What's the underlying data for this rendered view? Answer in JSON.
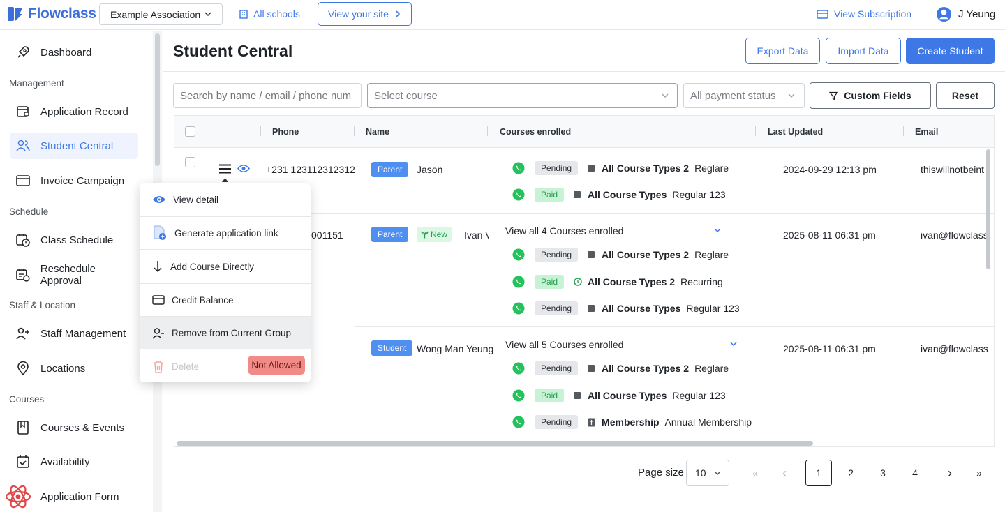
{
  "brand": {
    "name": "Flowclass",
    "color": "#3d78e6"
  },
  "topbar": {
    "association": "Example Association",
    "all_schools": "All schools",
    "view_site": "View your site",
    "view_subscription": "View Subscription",
    "user_name": "J Yeung"
  },
  "sidebar": {
    "dashboard": "Dashboard",
    "sections": {
      "management": "Management",
      "schedule": "Schedule",
      "staff_location": "Staff & Location",
      "courses": "Courses"
    },
    "items": {
      "application_record": "Application Record",
      "student_central": "Student Central",
      "invoice_campaign": "Invoice Campaign",
      "class_schedule": "Class Schedule",
      "reschedule_approval": "Reschedule Approval",
      "staff_management": "Staff Management",
      "locations": "Locations",
      "courses_events": "Courses & Events",
      "availability": "Availability",
      "application_form": "Application Form"
    }
  },
  "page": {
    "title": "Student Central",
    "export": "Export Data",
    "import": "Import Data",
    "create": "Create Student"
  },
  "filters": {
    "search_placeholder": "Search by name / email / phone num",
    "course_placeholder": "Select course",
    "payment_placeholder": "All payment status",
    "custom_fields": "Custom Fields",
    "reset": "Reset"
  },
  "table": {
    "headers": {
      "phone": "Phone",
      "name": "Name",
      "courses": "Courses enrolled",
      "updated": "Last Updated",
      "email": "Email"
    },
    "rows": [
      {
        "phone": "+231 123112312312",
        "role": "Parent",
        "name": "Jason",
        "updated": "2024-09-29 12:13 pm",
        "email": "thiswillnotbeint",
        "courses": [
          {
            "status": "Pending",
            "type": "All Course Types 2",
            "course": "Reglare"
          },
          {
            "status": "Paid",
            "type": "All Course Types",
            "course": "Regular 123"
          }
        ]
      },
      {
        "phone": "001151",
        "role": "Parent",
        "badge": "New",
        "name": "Ivan V",
        "updated": "2025-08-11 06:31 pm",
        "email": "ivan@flowclass",
        "view_all": "View all 4 Courses enrolled",
        "courses": [
          {
            "status": "Pending",
            "type": "All Course Types 2",
            "course": "Reglare"
          },
          {
            "status": "Paid",
            "type": "All Course Types 2",
            "course": "Recurring"
          },
          {
            "status": "Pending",
            "type": "All Course Types",
            "course": "Regular 123"
          }
        ]
      },
      {
        "role": "Student",
        "name": "Wong Man Yeung",
        "updated": "2025-08-11 06:31 pm",
        "email": "ivan@flowclass",
        "view_all": "View all 5 Courses enrolled",
        "courses": [
          {
            "status": "Pending",
            "type": "All Course Types 2",
            "course": "Reglare"
          },
          {
            "status": "Paid",
            "type": "All Course Types",
            "course": "Regular 123"
          },
          {
            "status": "Pending",
            "type": "Membership",
            "course": "Annual Membership"
          }
        ]
      }
    ]
  },
  "context_menu": {
    "view_detail": "View detail",
    "gen_link": "Generate application link",
    "add_course": "Add Course Directly",
    "credit": "Credit Balance",
    "remove_group": "Remove from Current Group",
    "delete": "Delete",
    "not_allowed": "Not Allowed"
  },
  "pagination": {
    "label": "Page size",
    "size": "10",
    "first": "«",
    "prev": "‹",
    "pages": [
      "1",
      "2",
      "3",
      "4"
    ],
    "next": "›",
    "last": "»"
  }
}
